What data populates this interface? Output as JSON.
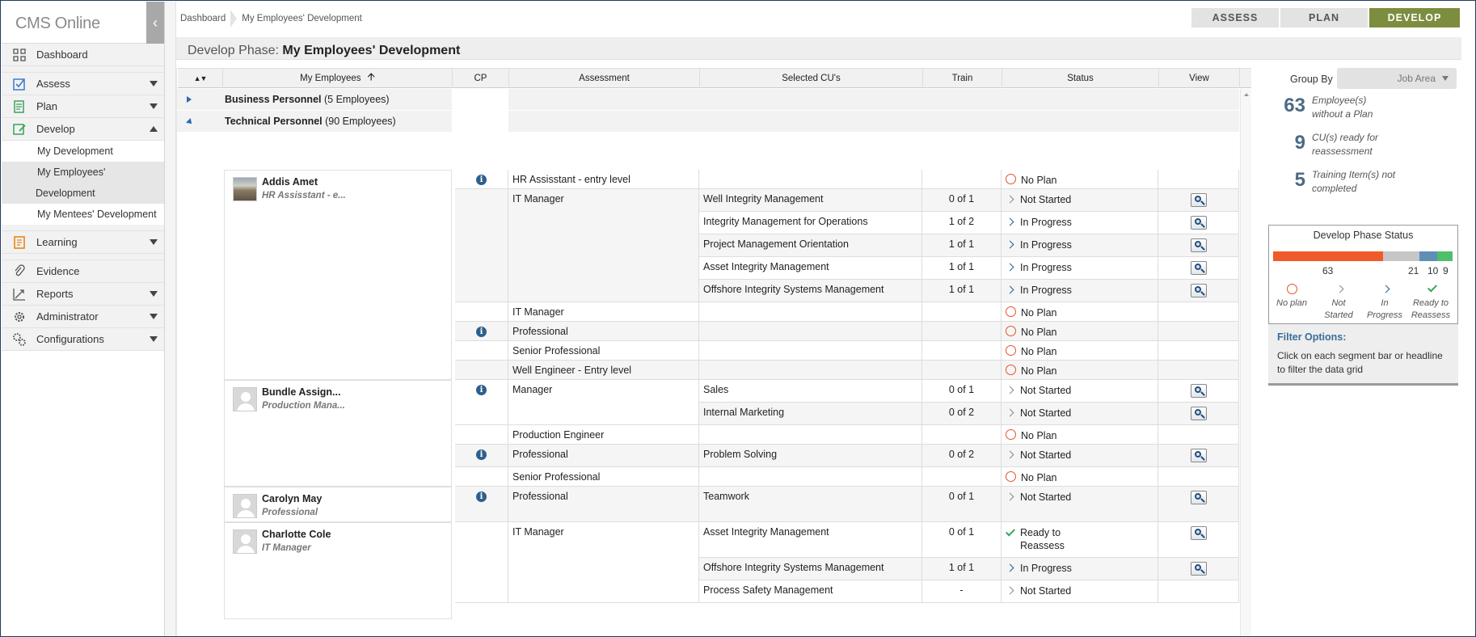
{
  "app": {
    "title": "CMS Online"
  },
  "sidebar": {
    "items": [
      {
        "label": "Dashboard",
        "icon": "dashboard-icon"
      },
      {
        "label": "Assess",
        "icon": "assess-icon"
      },
      {
        "label": "Plan",
        "icon": "plan-icon"
      },
      {
        "label": "Develop",
        "icon": "develop-icon"
      },
      {
        "label": "Learning",
        "icon": "learning-icon"
      },
      {
        "label": "Evidence",
        "icon": "paperclip-icon"
      },
      {
        "label": "Reports",
        "icon": "reports-icon"
      },
      {
        "label": "Administrator",
        "icon": "gear-icon"
      },
      {
        "label": "Configurations",
        "icon": "configurations-icon"
      }
    ],
    "develop_sub": [
      "My Development",
      "My Employees'",
      "Development",
      "My Mentees' Development"
    ]
  },
  "breadcrumb": [
    "Dashboard",
    "My Employees' Development"
  ],
  "phases": [
    "ASSESS",
    "PLAN",
    "DEVELOP"
  ],
  "page": {
    "title_prefix": "Develop Phase:",
    "title": "My Employees' Development"
  },
  "grid": {
    "headers": {
      "employees": "My Employees",
      "cp": "CP",
      "assessment": "Assessment",
      "cus": "Selected CU's",
      "train": "Train",
      "status": "Status",
      "view": "View"
    },
    "groups": [
      {
        "name": "Business Personnel",
        "count": "(5 Employees)"
      },
      {
        "name": "Technical Personnel",
        "count": "(90 Employees)"
      }
    ],
    "employees": [
      {
        "name": "Addis Amet",
        "role": "HR Assisstant - e..."
      },
      {
        "name": "Bundle Assign...",
        "role": "Production Mana..."
      },
      {
        "name": "Carolyn May",
        "role": "Professional"
      },
      {
        "name": "Charlotte Cole",
        "role": "IT Manager"
      }
    ],
    "rows": [
      {
        "assessment": "HR Assisstant - entry level",
        "cu": "",
        "train": "",
        "status": "No Plan"
      },
      {
        "assessment": "IT Manager",
        "cu": "Well Integrity Management",
        "train": "0 of 1",
        "status": "Not Started"
      },
      {
        "assessment": "",
        "cu": "Integrity Management for Operations",
        "train": "1 of 2",
        "status": "In Progress"
      },
      {
        "assessment": "",
        "cu": "Project Management Orientation",
        "train": "1 of 1",
        "status": "In Progress"
      },
      {
        "assessment": "",
        "cu": "Asset Integrity Management",
        "train": "1 of 1",
        "status": "In Progress"
      },
      {
        "assessment": "",
        "cu": "Offshore Integrity Systems Management",
        "train": "1 of 1",
        "status": "In Progress"
      },
      {
        "assessment": "IT Manager",
        "cu": "",
        "train": "",
        "status": "No Plan"
      },
      {
        "assessment": "Professional",
        "cu": "",
        "train": "",
        "status": "No Plan"
      },
      {
        "assessment": "Senior Professional",
        "cu": "",
        "train": "",
        "status": "No Plan"
      },
      {
        "assessment": "Well Engineer - Entry level",
        "cu": "",
        "train": "",
        "status": "No Plan"
      },
      {
        "assessment": "Manager",
        "cu": "Sales",
        "train": "0 of 1",
        "status": "Not Started"
      },
      {
        "assessment": "",
        "cu": "Internal Marketing",
        "train": "0 of 2",
        "status": "Not Started"
      },
      {
        "assessment": "Production Engineer",
        "cu": "",
        "train": "",
        "status": "No Plan"
      },
      {
        "assessment": "Professional",
        "cu": "Problem Solving",
        "train": "0 of 2",
        "status": "Not Started"
      },
      {
        "assessment": "Senior Professional",
        "cu": "",
        "train": "",
        "status": "No Plan"
      },
      {
        "assessment": "Professional",
        "cu": "Teamwork",
        "train": "0 of 1",
        "status": "Not Started"
      },
      {
        "assessment": "IT Manager",
        "cu": "Asset Integrity Management",
        "train": "0 of 1",
        "status": "Ready to",
        "status2": "Reassess"
      },
      {
        "assessment": "",
        "cu": "Offshore Integrity Systems Management",
        "train": "1 of 1",
        "status": "In Progress"
      },
      {
        "assessment": "",
        "cu": "Process Safety Management",
        "train": "-",
        "status": "Not Started"
      }
    ]
  },
  "right": {
    "group_by_label": "Group By",
    "group_by_value": "Job Area",
    "stats": [
      {
        "num": "63",
        "line1": "Employee(s)",
        "line2": "without a Plan"
      },
      {
        "num": "9",
        "line1": "CU(s) ready for",
        "line2": "reassessment"
      },
      {
        "num": "5",
        "line1": "Training Item(s) not",
        "line2": "completed"
      }
    ],
    "dps_title": "Develop Phase Status",
    "segments": [
      {
        "label": "63",
        "value": 63,
        "color": "#f05a2a"
      },
      {
        "label": "21",
        "value": 21,
        "color": "#c6c6c6"
      },
      {
        "label": "10",
        "value": 10,
        "color": "#5f8fb6"
      },
      {
        "label": "9",
        "value": 9,
        "color": "#4fbf6a"
      }
    ],
    "legend": [
      {
        "l1": "No plan",
        "l2": ""
      },
      {
        "l1": "Not",
        "l2": "Started"
      },
      {
        "l1": "In",
        "l2": "Progress"
      },
      {
        "l1": "Ready to",
        "l2": "Reassess"
      }
    ],
    "filter_title": "Filter Options:",
    "filter_text": "Click on each segment bar or headline to filter the data grid"
  }
}
